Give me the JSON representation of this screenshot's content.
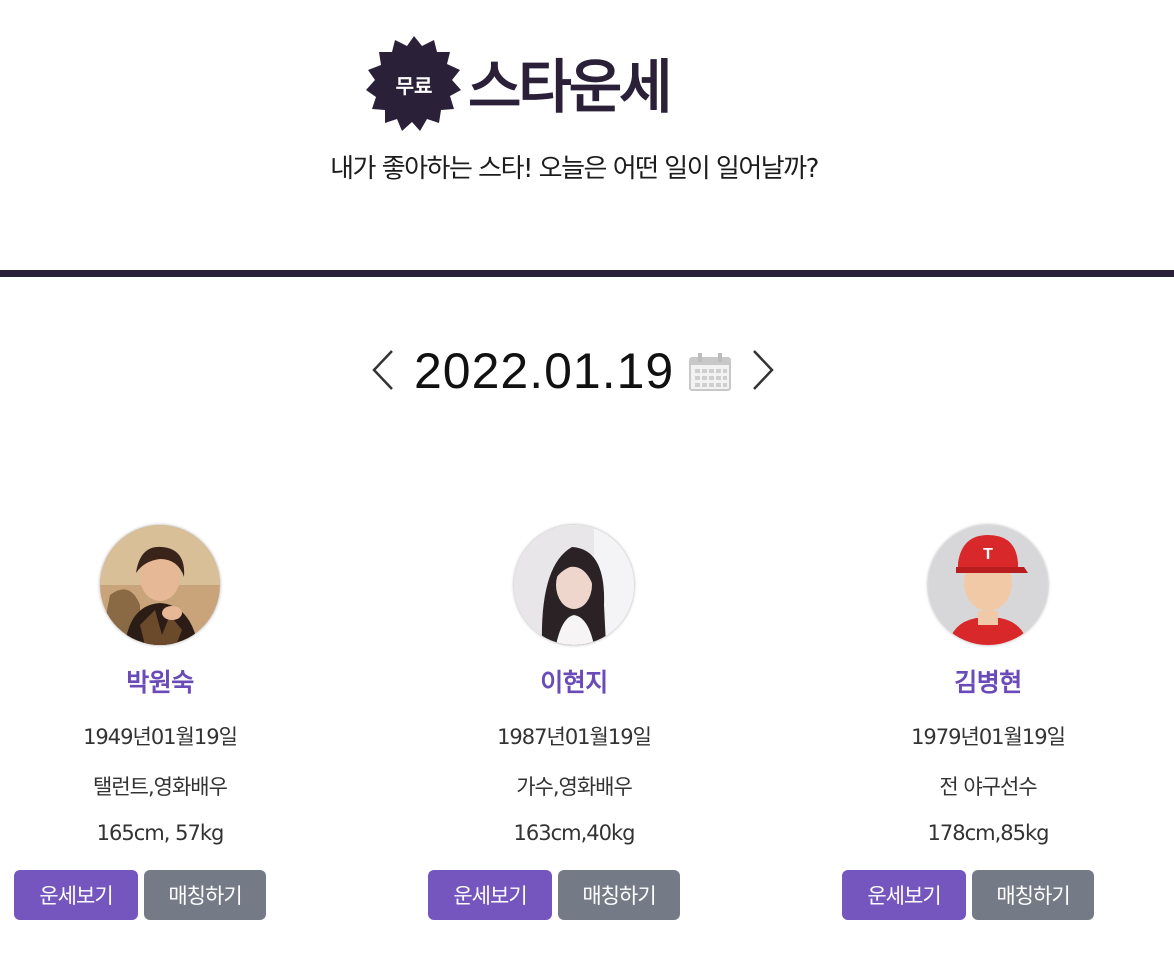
{
  "header": {
    "badge": "무료",
    "title": "스타운세",
    "subtitle": "내가 좋아하는 스타! 오늘은 어떤 일이 일어날까?"
  },
  "date_nav": {
    "date": "2022.01.19",
    "prev_icon": "chevron-left-icon",
    "next_icon": "chevron-right-icon",
    "calendar_icon": "calendar-icon"
  },
  "stars": [
    {
      "name": "박원숙",
      "birth": "1949년01월19일",
      "job": "탤런트,영화배우",
      "body": "165cm, 57kg",
      "fortune_label": "운세보기",
      "match_label": "매칭하기"
    },
    {
      "name": "이현지",
      "birth": "1987년01월19일",
      "job": "가수,영화배우",
      "body": "163cm,40kg",
      "fortune_label": "운세보기",
      "match_label": "매칭하기"
    },
    {
      "name": "김병현",
      "birth": "1979년01월19일",
      "job": "전 야구선수",
      "body": "178cm,85kg",
      "fortune_label": "운세보기",
      "match_label": "매칭하기"
    }
  ],
  "colors": {
    "primary_dark": "#2a2038",
    "accent_purple": "#7456be",
    "name_purple": "#6a4bb8",
    "button_gray": "#757b86"
  }
}
